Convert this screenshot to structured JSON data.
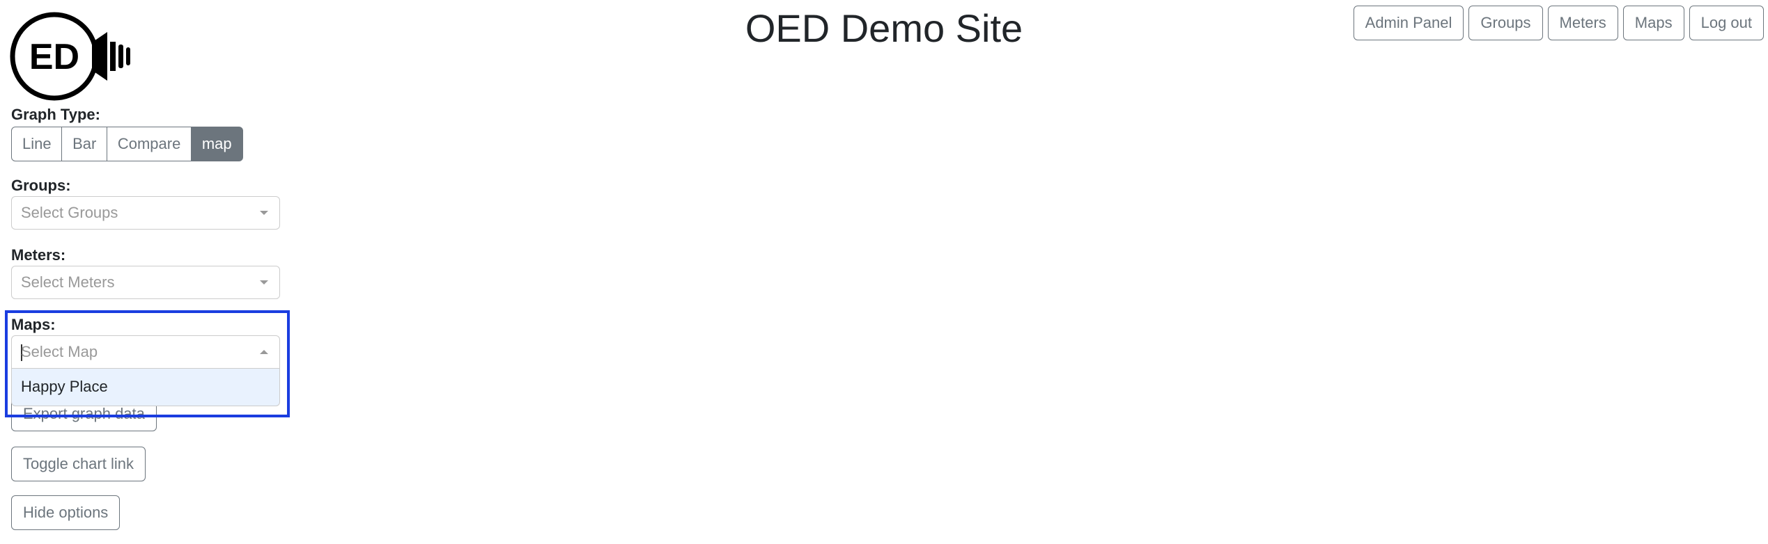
{
  "header": {
    "title": "OED Demo Site",
    "nav": [
      "Admin Panel",
      "Groups",
      "Meters",
      "Maps",
      "Log out"
    ]
  },
  "logo": {
    "text": "ED"
  },
  "options": {
    "graph_type_label": "Graph Type:",
    "graph_types": [
      "Line",
      "Bar",
      "Compare",
      "map"
    ],
    "active_graph_type": "map",
    "groups_label": "Groups:",
    "groups_placeholder": "Select Groups",
    "meters_label": "Meters:",
    "meters_placeholder": "Select Meters",
    "maps_label": "Maps:",
    "maps_placeholder": "Select Map",
    "maps_options": [
      "Happy Place"
    ],
    "export_label": "Export graph data",
    "toggle_chart_link_label": "Toggle chart link",
    "hide_options_label": "Hide options"
  },
  "colors": {
    "highlight": "#1a3de0",
    "secondary": "#6c757d",
    "option_hover": "#e9f2fe"
  }
}
